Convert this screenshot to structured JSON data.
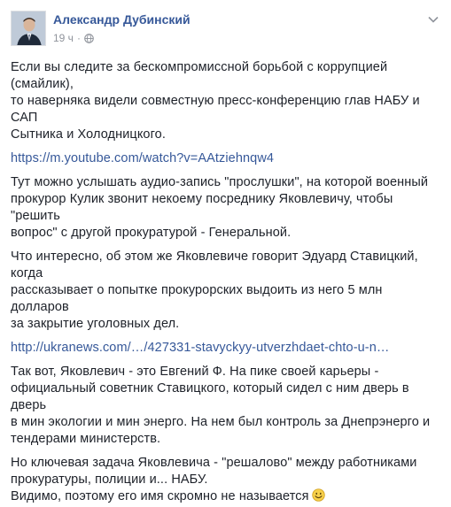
{
  "post": {
    "author": "Александр Дубинский",
    "time": "19 ч",
    "dot": "·",
    "paragraphs": [
      [
        "Если вы следите за бескомпромиссной борьбой с коррупцией (смайлик),",
        "то наверняка видели совместную пресс-конференцию глав НАБУ и САП",
        "Сытника и Холодницкого."
      ],
      [
        "Тут можно услышать аудио-запись \"прослушки\", на которой военный",
        "прокурор Кулик звонит некоему посреднику Яковлевичу, чтобы \"решить",
        "вопрос\" с другой прокуратурой - Генеральной."
      ],
      [
        "Что интересно, об этом же Яковлевиче говорит Эдуард Ставицкий, когда",
        "рассказывает о попытке прокурорских выдоить из него 5 млн долларов",
        "за закрытие уголовных дел."
      ],
      [
        "Так вот, Яковлевич - это Евгений Ф. На пике своей карьеры -",
        "официальный советник Ставицкого, который сидел с ним дверь в дверь",
        "в мин экологии и мин энерго. На нем был контроль за Днепрэнерго и",
        "тендерами министерств."
      ],
      [
        "Но ключевая задача Яковлевича - \"решалово\" между работниками",
        "прокуратуры, полиции и... НАБУ."
      ],
      [
        "Видимо, поэтому его имя скромно не называется"
      ]
    ],
    "links": [
      "https://m.youtube.com/watch?v=AAtziehnqw4",
      "http://ukranews.com/…/427331-stavyckyy-utverzhdaet-chto-u-n…"
    ],
    "icons": {
      "privacy": "globe-icon",
      "menu": "chevron-down-icon",
      "emoji": "smiley-emoji-icon"
    }
  }
}
